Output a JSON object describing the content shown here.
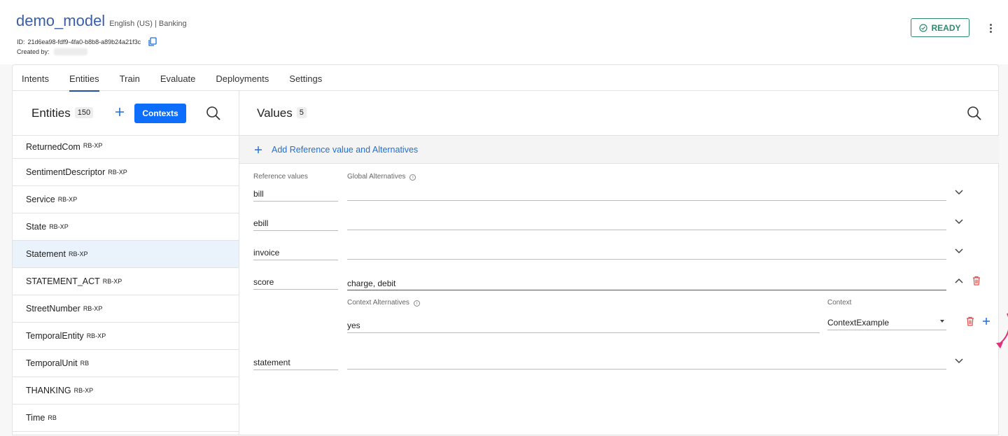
{
  "header": {
    "model_name": "demo_model",
    "model_meta": "English (US) | Banking",
    "id_label": "ID:",
    "id_value": "21d6ea98-fdf9-4fa0-b8b8-a89b24a21f3c",
    "created_by_label": "Created by:",
    "status_label": "READY",
    "status_color": "#2e8b6a"
  },
  "tabs": [
    {
      "label": "Intents"
    },
    {
      "label": "Entities"
    },
    {
      "label": "Train"
    },
    {
      "label": "Evaluate"
    },
    {
      "label": "Deployments"
    },
    {
      "label": "Settings"
    }
  ],
  "active_tab": "Entities",
  "entities_panel": {
    "title": "Entities",
    "count": "150",
    "contexts_label": "Contexts",
    "items": [
      {
        "name": "ReturnedCom",
        "tag": "RB-XP"
      },
      {
        "name": "SentimentDescriptor",
        "tag": "RB-XP"
      },
      {
        "name": "Service",
        "tag": "RB-XP"
      },
      {
        "name": "State",
        "tag": "RB-XP"
      },
      {
        "name": "Statement",
        "tag": "RB-XP"
      },
      {
        "name": "STATEMENT_ACT",
        "tag": "RB-XP"
      },
      {
        "name": "StreetNumber",
        "tag": "RB-XP"
      },
      {
        "name": "TemporalEntity",
        "tag": "RB-XP"
      },
      {
        "name": "TemporalUnit",
        "tag": "RB"
      },
      {
        "name": "THANKING",
        "tag": "RB-XP"
      },
      {
        "name": "Time",
        "tag": "RB"
      }
    ],
    "selected": "Statement"
  },
  "values_panel": {
    "title": "Values",
    "count": "5",
    "add_label": "Add Reference value and Alternatives",
    "ref_values_label": "Reference values",
    "global_alt_label": "Global Alternatives",
    "context_alt_label": "Context Alternatives",
    "context_label": "Context",
    "rows": [
      {
        "ref": "bill",
        "alternatives": ""
      },
      {
        "ref": "ebill",
        "alternatives": ""
      },
      {
        "ref": "invoice",
        "alternatives": ""
      },
      {
        "ref": "score",
        "alternatives": "charge, debit"
      },
      {
        "ref": "statement",
        "alternatives": ""
      }
    ],
    "context_row": {
      "alternative": "yes",
      "context": "ContextExample"
    }
  },
  "colors": {
    "accent": "#0d6efd",
    "link": "#1f6fd6",
    "delete": "#e04a4a",
    "annotation": "#e0307a"
  }
}
